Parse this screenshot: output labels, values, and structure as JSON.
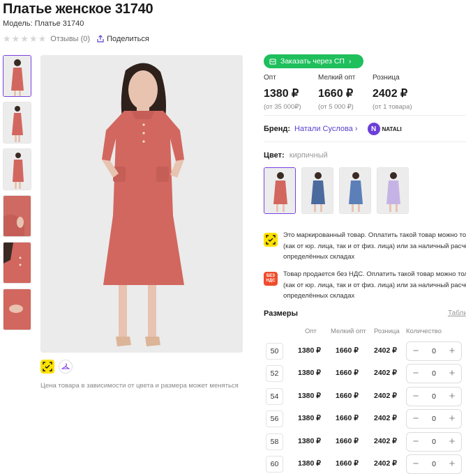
{
  "product": {
    "title": "Платье женское 31740",
    "model": "Модель: Платье 31740",
    "reviews": "Отзывы (0)",
    "share": "Поделиться",
    "price_note": "Цена товара в зависимости от цвета и размера может меняться"
  },
  "order_button": "Заказать через СП",
  "prices": [
    {
      "label": "Опт",
      "value": "1380 ₽",
      "sub": "(от 35 000₽)"
    },
    {
      "label": "Мелкий опт",
      "value": "1660 ₽",
      "sub": "(от 5 000 ₽)"
    },
    {
      "label": "Розница",
      "value": "2402 ₽",
      "sub": "(от 1 товара)"
    }
  ],
  "brand": {
    "label": "Бренд:",
    "name": "Натали Суслова",
    "logo_text": "NATALI"
  },
  "color": {
    "label": "Цвет:",
    "value": "кирпичный"
  },
  "info": [
    {
      "lines": [
        "Это маркированный товар. Оплатить такой товар можно тол",
        "(как от юр. лица, так и от физ. лица) или за наличный расчё",
        "определённых складах"
      ]
    },
    {
      "badge": "БЕЗ НДС",
      "lines": [
        "Товар продается без НДС. Оплатить такой товар можно тол",
        "(как от юр. лица, так и от физ. лица) или за наличный расчё",
        "определённых складах"
      ]
    }
  ],
  "sizes": {
    "title": "Размеры",
    "link": "Табли",
    "headers": {
      "opt": "Опт",
      "small_opt": "Мелкий опт",
      "retail": "Розница",
      "qty": "Количество"
    },
    "rows": [
      {
        "size": "50",
        "opt": "1380 ₽",
        "small_opt": "1660 ₽",
        "retail": "2402 ₽",
        "qty": "0"
      },
      {
        "size": "52",
        "opt": "1380 ₽",
        "small_opt": "1660 ₽",
        "retail": "2402 ₽",
        "qty": "0"
      },
      {
        "size": "54",
        "opt": "1380 ₽",
        "small_opt": "1660 ₽",
        "retail": "2402 ₽",
        "qty": "0"
      },
      {
        "size": "56",
        "opt": "1380 ₽",
        "small_opt": "1660 ₽",
        "retail": "2402 ₽",
        "qty": "0"
      },
      {
        "size": "58",
        "opt": "1380 ₽",
        "small_opt": "1660 ₽",
        "retail": "2402 ₽",
        "qty": "0"
      },
      {
        "size": "60",
        "opt": "1380 ₽",
        "small_opt": "1660 ₽",
        "retail": "2402 ₽",
        "qty": "0"
      }
    ]
  },
  "colors": {
    "accent": "#7b3fe4",
    "green": "#1fbf5c",
    "brand_link": "#5a3fd0",
    "marker_yellow": "#ffe100",
    "dress": "#d2675f"
  },
  "icons": [
    "star-icon",
    "share-icon",
    "cart-icon",
    "chevron-right-icon",
    "marking-icon",
    "hanger-icon",
    "no-vat-icon",
    "plus-icon",
    "minus-icon"
  ]
}
